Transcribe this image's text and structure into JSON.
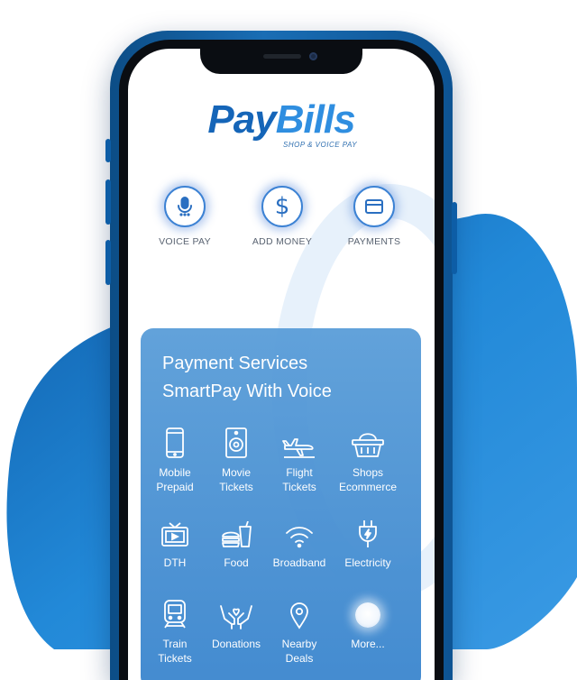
{
  "brand": {
    "name_part1": "Pay",
    "name_part2": "Bills",
    "tagline": "SHOP & VOICE PAY"
  },
  "quick_actions": [
    {
      "label": "VOICE PAY",
      "icon": "microphone-icon"
    },
    {
      "label": "ADD MONEY",
      "icon": "dollar-icon"
    },
    {
      "label": "PAYMENTS",
      "icon": "credit-card-icon"
    }
  ],
  "panel": {
    "title_line1": "Payment Services",
    "title_line2": "SmartPay With Voice",
    "services": [
      {
        "label": "Mobile\nPrepaid",
        "icon": "mobile-phone-icon"
      },
      {
        "label": "Movie\nTickets",
        "icon": "movie-speaker-icon"
      },
      {
        "label": "Flight\nTickets",
        "icon": "airplane-icon"
      },
      {
        "label": "Shops\nEcommerce",
        "icon": "shopping-basket-icon"
      },
      {
        "label": "DTH",
        "icon": "tv-icon"
      },
      {
        "label": "Food",
        "icon": "food-icon"
      },
      {
        "label": "Broadband",
        "icon": "wifi-icon"
      },
      {
        "label": "Electricity",
        "icon": "plug-icon"
      },
      {
        "label": "Train\nTickets",
        "icon": "train-icon"
      },
      {
        "label": "Donations",
        "icon": "hands-icon"
      },
      {
        "label": "Nearby\nDeals",
        "icon": "location-pin-icon"
      },
      {
        "label": "More...",
        "icon": "more-dot-icon"
      }
    ]
  },
  "colors": {
    "brand_dark": "#1565b8",
    "brand_light": "#2f8ee0",
    "panel": "#4a92d4",
    "blob": "#1f7fd0"
  }
}
